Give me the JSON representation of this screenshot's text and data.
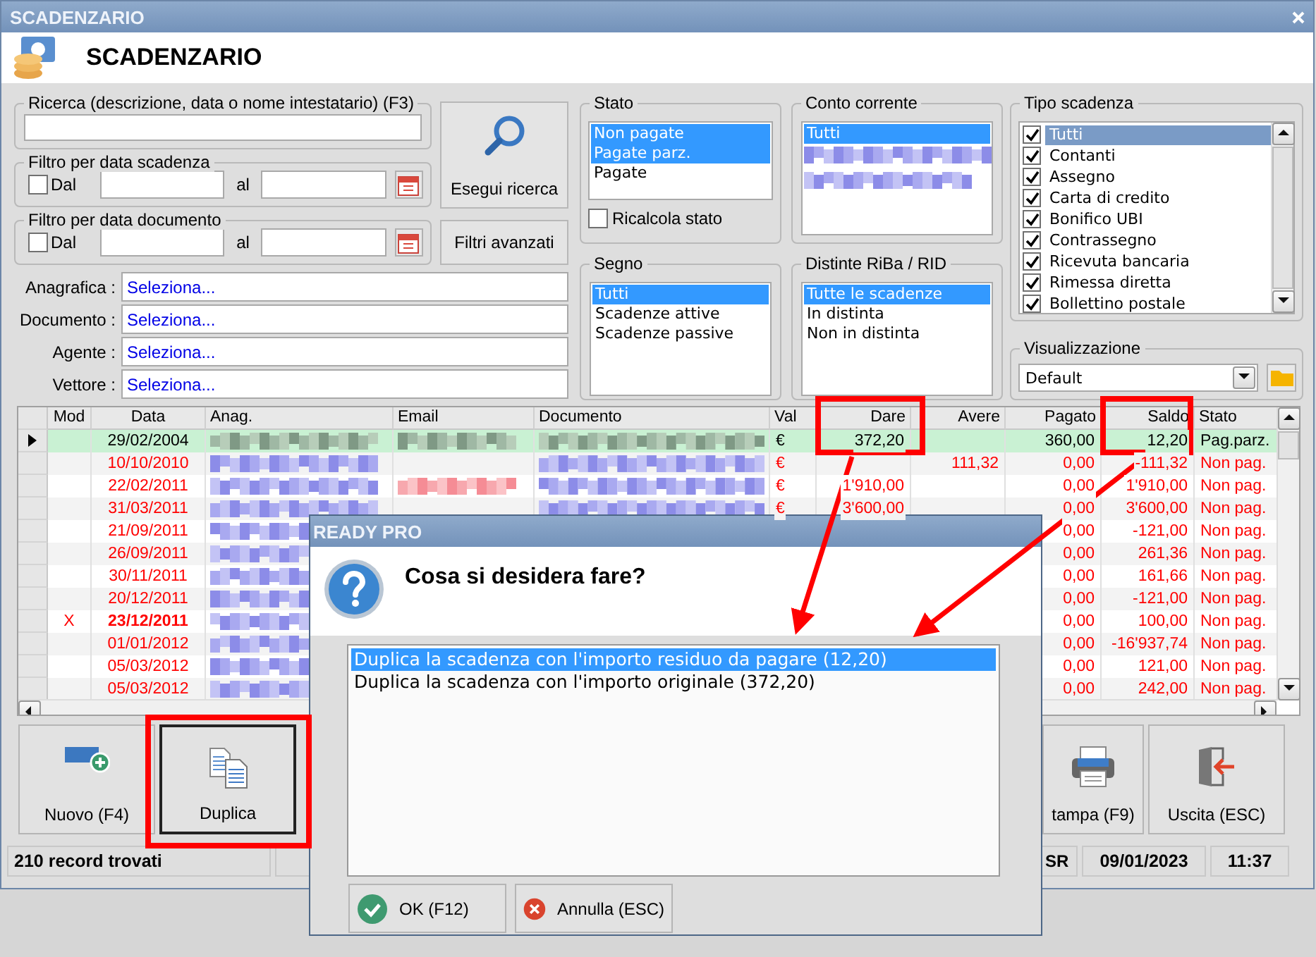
{
  "window": {
    "title": "SCADENZARIO"
  },
  "header": {
    "title": "SCADENZARIO"
  },
  "search": {
    "label": "Ricerca (descrizione, data o nome intestatario) (F3)",
    "button": "Esegui ricerca",
    "advanced_button": "Filtri avanzati"
  },
  "date_filters": [
    {
      "title": "Filtro per data scadenza",
      "from_label": "Dal",
      "checked": false,
      "to_label": "al"
    },
    {
      "title": "Filtro per data documento",
      "from_label": "Dal",
      "checked": false,
      "to_label": "al"
    }
  ],
  "lookups": [
    {
      "label": "Anagrafica :",
      "value": "Seleziona..."
    },
    {
      "label": "Documento :",
      "value": "Seleziona..."
    },
    {
      "label": "Agente :",
      "value": "Seleziona..."
    },
    {
      "label": "Vettore :",
      "value": "Seleziona..."
    }
  ],
  "stato": {
    "title": "Stato",
    "items": [
      {
        "label": "Non pagate",
        "selected": true
      },
      {
        "label": "Pagate parz.",
        "selected": true
      },
      {
        "label": "Pagate",
        "selected": false
      }
    ],
    "recalc": {
      "label": "Ricalcola stato",
      "checked": false
    }
  },
  "segno": {
    "title": "Segno",
    "items": [
      {
        "label": "Tutti",
        "selected": true
      },
      {
        "label": "Scadenze attive",
        "selected": false
      },
      {
        "label": "Scadenze passive",
        "selected": false
      }
    ]
  },
  "conto_corrente": {
    "title": "Conto corrente",
    "items": [
      {
        "label": "Tutti",
        "selected": true
      }
    ]
  },
  "distinte": {
    "title": "Distinte RiBa / RID",
    "items": [
      {
        "label": "Tutte le scadenze",
        "selected": true
      },
      {
        "label": "In distinta",
        "selected": false
      },
      {
        "label": "Non in distinta",
        "selected": false
      }
    ]
  },
  "tipo_scadenza": {
    "title": "Tipo scadenza",
    "items": [
      {
        "label": "Tutti",
        "checked": true,
        "selected": true
      },
      {
        "label": "Contanti",
        "checked": true,
        "selected": false
      },
      {
        "label": "Assegno",
        "checked": true,
        "selected": false
      },
      {
        "label": "Carta di credito",
        "checked": true,
        "selected": false
      },
      {
        "label": "Bonifico UBI",
        "checked": true,
        "selected": false
      },
      {
        "label": "Contrassegno",
        "checked": true,
        "selected": false
      },
      {
        "label": "Ricevuta bancaria",
        "checked": true,
        "selected": false
      },
      {
        "label": "Rimessa diretta",
        "checked": true,
        "selected": false
      },
      {
        "label": "Bollettino postale",
        "checked": true,
        "selected": false
      }
    ]
  },
  "visualizzazione": {
    "title": "Visualizzazione",
    "value": "Default"
  },
  "table": {
    "columns": [
      "Mod",
      "Data",
      "Anag.",
      "Email",
      "Documento",
      "Val",
      "Dare",
      "Avere",
      "Pagato",
      "Saldo",
      "Stato"
    ],
    "rows": [
      {
        "mod": "",
        "data": "29/02/2004",
        "email_redacted": true,
        "val": "€",
        "dare": "372,20",
        "avere": "",
        "pagato": "360,00",
        "saldo": "12,20",
        "stato": "Pag.parz.",
        "selected": true,
        "overdue": false,
        "emphasized": false
      },
      {
        "mod": "",
        "data": "10/10/2010",
        "email_redacted": false,
        "val": "€",
        "dare": "",
        "avere": "111,32",
        "pagato": "0,00",
        "saldo": "-111,32",
        "stato": "Non pag.",
        "selected": false,
        "overdue": true,
        "emphasized": false
      },
      {
        "mod": "",
        "data": "22/02/2011",
        "email_redacted": true,
        "val": "€",
        "dare": "1'910,00",
        "avere": "",
        "pagato": "0,00",
        "saldo": "1'910,00",
        "stato": "Non pag.",
        "selected": false,
        "overdue": true,
        "emphasized": false
      },
      {
        "mod": "",
        "data": "31/03/2011",
        "email_redacted": false,
        "val": "€",
        "dare": "3'600,00",
        "avere": "",
        "pagato": "0,00",
        "saldo": "3'600,00",
        "stato": "Non pag.",
        "selected": false,
        "overdue": true,
        "emphasized": false
      },
      {
        "mod": "",
        "data": "21/09/2011",
        "pagato": "0,00",
        "saldo": "-121,00",
        "stato": "Non pag.",
        "selected": false,
        "overdue": true,
        "emphasized": false
      },
      {
        "mod": "",
        "data": "26/09/2011",
        "pagato": "0,00",
        "saldo": "261,36",
        "stato": "Non pag.",
        "selected": false,
        "overdue": true,
        "emphasized": false
      },
      {
        "mod": "",
        "data": "30/11/2011",
        "pagato": "0,00",
        "saldo": "161,66",
        "stato": "Non pag.",
        "selected": false,
        "overdue": true,
        "emphasized": false
      },
      {
        "mod": "",
        "data": "20/12/2011",
        "pagato": "0,00",
        "saldo": "-121,00",
        "stato": "Non pag.",
        "selected": false,
        "overdue": true,
        "emphasized": false
      },
      {
        "mod": "X",
        "data": "23/12/2011",
        "pagato": "0,00",
        "saldo": "100,00",
        "stato": "Non pag.",
        "selected": false,
        "overdue": true,
        "emphasized": true
      },
      {
        "mod": "",
        "data": "01/01/2012",
        "pagato": "0,00",
        "saldo": "-16'937,74",
        "stato": "Non pag.",
        "selected": false,
        "overdue": true,
        "emphasized": false
      },
      {
        "mod": "",
        "data": "05/03/2012",
        "pagato": "0,00",
        "saldo": "121,00",
        "stato": "Non pag.",
        "selected": false,
        "overdue": true,
        "emphasized": false
      },
      {
        "mod": "",
        "data": "05/03/2012",
        "pagato": "0,00",
        "saldo": "242,00",
        "stato": "Non pag.",
        "selected": false,
        "overdue": true,
        "emphasized": false
      }
    ]
  },
  "toolbar": [
    {
      "label": "Nuovo (F4)",
      "kind": "new",
      "focused": false
    },
    {
      "label": "Duplica",
      "kind": "duplicate",
      "focused": true
    }
  ],
  "toolbar_right": [
    {
      "label": "tampa (F9)",
      "kind": "print",
      "focused": false
    },
    {
      "label": "Uscita (ESC)",
      "kind": "exit",
      "focused": false
    }
  ],
  "status_bar": {
    "records": "210 record trovati",
    "user": "SR",
    "date": "09/01/2023",
    "time": "11:37"
  },
  "dialog": {
    "title": "READY PRO",
    "question": "Cosa si desidera fare?",
    "options": [
      {
        "label": "Duplica la scadenza con l'importo residuo da pagare (12,20)",
        "selected": true
      },
      {
        "label": "Duplica la scadenza con l'importo originale (372,20)",
        "selected": false
      }
    ],
    "buttons": [
      {
        "label": "OK (F12)",
        "kind": "ok"
      },
      {
        "label": "Annulla (ESC)",
        "kind": "cancel"
      }
    ]
  }
}
